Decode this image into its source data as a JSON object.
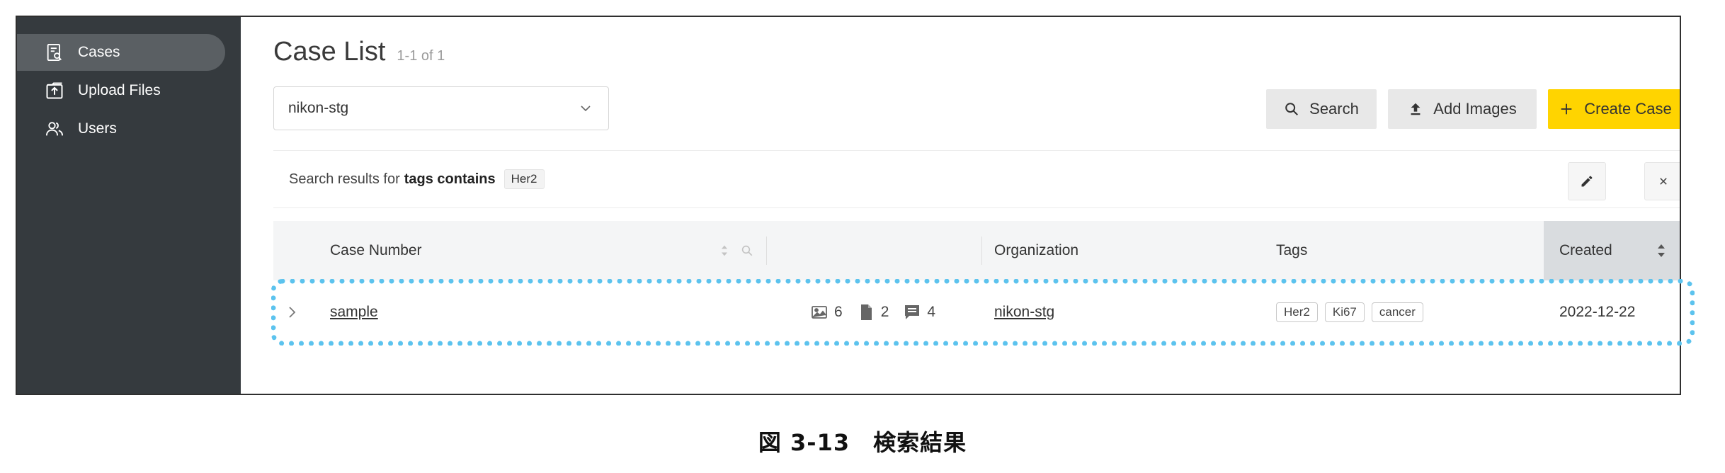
{
  "sidebar": {
    "items": [
      {
        "label": "Cases",
        "icon": "case-search-icon",
        "active": true
      },
      {
        "label": "Upload Files",
        "icon": "upload-icon",
        "active": false
      },
      {
        "label": "Users",
        "icon": "users-icon",
        "active": false
      }
    ]
  },
  "header": {
    "title": "Case List",
    "count": "1-1 of 1"
  },
  "org_select": {
    "value": "nikon-stg"
  },
  "toolbar": {
    "search_label": "Search",
    "add_images_label": "Add Images",
    "create_case_label": "Create Case"
  },
  "filter": {
    "prefix": "Search results for",
    "condition": "tags contains",
    "tag": "Her2"
  },
  "table": {
    "columns": {
      "case_number": "Case Number",
      "organization": "Organization",
      "tags": "Tags",
      "created": "Created"
    },
    "rows": [
      {
        "case_number": "sample",
        "images": "6",
        "documents": "2",
        "comments": "4",
        "organization": "nikon-stg",
        "tags": [
          "Her2",
          "Ki67",
          "cancer"
        ],
        "created": "2022-12-22"
      }
    ]
  },
  "caption": "図 3-13　検索結果",
  "colors": {
    "sidebar_bg": "#353a3e",
    "active_nav": "#5a5f63",
    "accent_yellow": "#ffd400",
    "highlight": "#5cc3ee"
  }
}
